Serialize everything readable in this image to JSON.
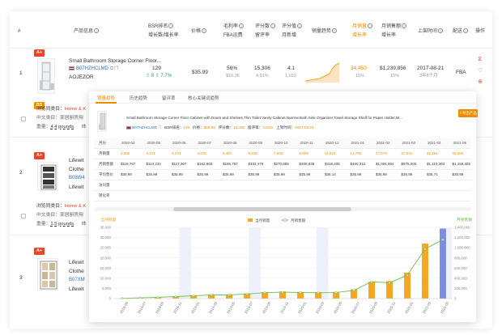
{
  "header": {
    "index": "#",
    "product_info": "产品信息",
    "bsr_rank": "BSR排名",
    "bsr_growth": "增长数/增长率",
    "price": "价格",
    "gross_margin": "毛利率",
    "fba_fee": "FBA运费",
    "rating_count": "评分数",
    "review_rate": "留评率",
    "rating": "评分值",
    "monthly_new": "月新增",
    "sales_trend": "销量趋势",
    "monthly_sales": "月销量",
    "sales_growth": "增长率",
    "monthly_revenue": "月销售额",
    "revenue_growth": "增长率",
    "launch_date": "上架时间",
    "delivery": "配送",
    "actions": "操作"
  },
  "rows": [
    {
      "index": "1",
      "badge1": "A+",
      "badge2": "BS",
      "title": "Small Bathroom Storage Corner Floor...",
      "asin": "B07HZHCLMD",
      "brand": "AOJEZOR",
      "bsr": "129",
      "bsr_growth_count": "8",
      "bsr_growth_rate": "7.7%",
      "price": "$35.99",
      "margin": "56%",
      "fba": "$10.36",
      "ratings": "15,306",
      "review_rate": "4.91%",
      "rating": "4.1",
      "monthly_new": "1,693",
      "monthly_sales": "34,450",
      "sales_growth": "15%",
      "revenue": "$1,239,856",
      "revenue_growth": "15%",
      "launch": "2017-08-21",
      "launch_sub": "3年8个月",
      "delivery": "FBA",
      "browse_label": "浏览同类目：",
      "browse_value": "Home & K",
      "category_label": "中文类目：家居厨房用",
      "weight_label": "重量：",
      "weight_value": "4.4 pounds",
      "size_label": "体"
    },
    {
      "index": "2",
      "badge1": "A+",
      "title1": "Lifewit",
      "title2": "Clothe",
      "asin": "B08W4",
      "brand": "Lifewit",
      "browse_label": "浏览同类目：",
      "browse_value": "Home & K",
      "category_label": "中文类目：家居厨房用",
      "weight_label": "重量：",
      "weight_value": "1.5 pounds",
      "size_label": "体"
    },
    {
      "index": "3",
      "badge1": "A+",
      "title1": "Lifewit",
      "title2": "Clothe",
      "asin": "B07XM",
      "brand": "Lifewit"
    }
  ],
  "popup": {
    "tabs": [
      "销量趋势",
      "历史趋势",
      "留评率",
      "核心关键词趋势"
    ],
    "product_title": "Small Bathroom Storage Corner Floor Cabinet with Doors and Shelves,Thin Toilet Vanity Cabinet,Narrow Bath Sink Organizer,Towel Storage Shelf for Paper Holder,W...",
    "asin": "B07HZHCLMD",
    "bsr_label": "BSR排名：",
    "bsr_value": "129",
    "price_label": "价格：",
    "price_value": "$35.99",
    "ratings_label": "评分数：",
    "ratings_value": "15,306",
    "review_label": "留评率：",
    "review_value": "4.91%",
    "launch_label": "上架时间：",
    "launch_value": "2017-08-21",
    "export": "导出产品",
    "table": {
      "month_label": "月份",
      "months": [
        "2020-04",
        "2020-05",
        "2020-06",
        "2020-07",
        "2020-08",
        "2020-09",
        "2020-10",
        "2020-11",
        "2020-12",
        "2021-01",
        "2021-02",
        "2021-03",
        "2021-04",
        "2021-05"
      ],
      "row_labels": [
        "月销量",
        "月销售额",
        "平均售价",
        "访问量",
        "转化率"
      ],
      "sales": [
        "3,300",
        "3,174",
        "3,274",
        "4,578",
        "5,467",
        "8,238",
        "7,526",
        "8,609",
        "11,523",
        "12,780",
        "27,979",
        "27,031",
        "31,161",
        "34,450"
      ],
      "revenue": [
        "$118,767",
        "$114,232",
        "$117,307",
        "$162,603",
        "$196,757",
        "$332,476",
        "$270,859",
        "$309,838",
        "$416,405",
        "$460,312",
        "$1,006,964",
        "$975,005",
        "$1,110,383",
        "$1,158,455"
      ],
      "avg_price": [
        "$35.99",
        "$35.99",
        "$35.99",
        "$35.99",
        "$35.99",
        "$35.99",
        "$35.99",
        "$35.99",
        "$36.14",
        "$35.99",
        "$35.99",
        "$35.99",
        "$35.71",
        "$35.99"
      ]
    }
  },
  "chart_data": {
    "type": "bar",
    "y_left_label": "当月销量",
    "y_right_label": "月销售额",
    "legend": [
      "当月销量",
      "月销售额"
    ],
    "legend_position": "top-center",
    "ylim_left": [
      0,
      35000
    ],
    "ylim_right": [
      0,
      1400000
    ],
    "y_left_ticks": [
      "35,000",
      "30,000",
      "25,000",
      "20,000",
      "15,000",
      "10,000",
      "5,000",
      "0"
    ],
    "y_right_ticks": [
      "1,400,000",
      "1,200,000",
      "1,000,000",
      "800,000",
      "600,000",
      "400,000",
      "200,000",
      "0"
    ],
    "categories": [
      "2018-05",
      "2018-07",
      "2018-09",
      "2018-11",
      "2019-01",
      "2019-03",
      "2019-05",
      "2019-07",
      "2019-09",
      "2019-11",
      "2020-01",
      "2020-03",
      "2020-05",
      "2020-07",
      "2020-09",
      "2020-11",
      "2021-01",
      "2021-03",
      "2021-05"
    ],
    "series": [
      {
        "name": "当月销量",
        "values": [
          150,
          400,
          700,
          1100,
          1500,
          2000,
          2000,
          2500,
          3200,
          3500,
          3300,
          3200,
          3274,
          4578,
          8238,
          8609,
          12780,
          27031,
          34450
        ],
        "color": "#f5a623"
      },
      {
        "name": "月销售额",
        "values": [
          5000,
          15000,
          26000,
          40000,
          55000,
          72000,
          72000,
          90000,
          116000,
          126000,
          119000,
          115000,
          117307,
          162603,
          332476,
          309838,
          460312,
          975005,
          1158455
        ],
        "color": "#6cc04a"
      }
    ]
  }
}
